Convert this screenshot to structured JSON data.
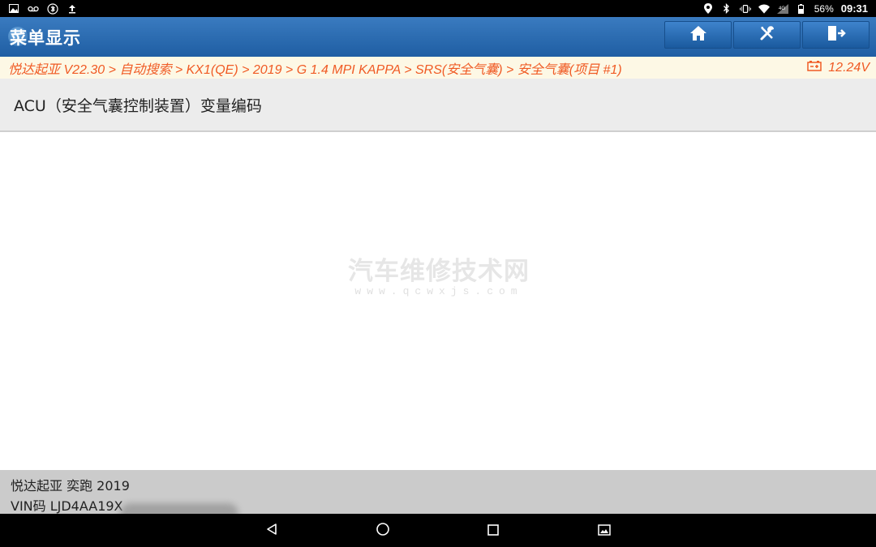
{
  "statusbar": {
    "left_icons": [
      "image-icon",
      "voicemail-icon",
      "bluetooth-icon",
      "upload-icon"
    ],
    "right_icons": [
      "location-icon",
      "bluetooth-icon",
      "vibrate-icon",
      "wifi-icon",
      "signal-icon",
      "battery-icon"
    ],
    "battery": "56%",
    "time": "09:31"
  },
  "titlebar": {
    "title": "菜单显示",
    "buttons": [
      {
        "icon": "home-icon"
      },
      {
        "icon": "tools-icon"
      },
      {
        "icon": "exit-icon"
      }
    ]
  },
  "breadcrumb": {
    "path": "悦达起亚 V22.30 > 自动搜索 > KX1(QE) > 2019 > G 1.4 MPI KAPPA > SRS(安全气囊) > 安全气囊(项目 #1)",
    "voltage_icon": "battery-voltage-icon",
    "voltage": "12.24V"
  },
  "section": {
    "title": "ACU（安全气囊控制装置）变量编码"
  },
  "watermark": {
    "text": "汽车维修技术网",
    "url": "www.qcwxjs.com"
  },
  "footer": {
    "vehicle": "悦达起亚 奕跑 2019",
    "vin": "VIN码 LJD4AA19X"
  },
  "navbar": {
    "icons": [
      "back-icon",
      "home-circle-icon",
      "recents-icon",
      "screenshot-icon"
    ]
  },
  "colors": {
    "titlebar": "#2a6cb3",
    "breadcrumb_text": "#f05a24",
    "breadcrumb_bg": "#fdf8e5",
    "footer_bg": "#cbcbcb"
  }
}
